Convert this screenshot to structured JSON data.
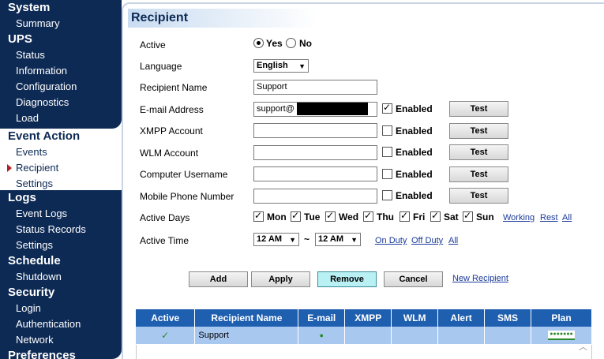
{
  "sidebar": {
    "sections": [
      {
        "title": "System",
        "items": [
          "Summary"
        ]
      },
      {
        "title": "UPS",
        "items": [
          "Status",
          "Information",
          "Configuration",
          "Diagnostics",
          "Load"
        ]
      },
      {
        "title": "Event Action",
        "items": [
          "Events",
          "Recipient",
          "Settings"
        ],
        "selected": "Recipient"
      },
      {
        "title": "Logs",
        "items": [
          "Event Logs",
          "Status Records",
          "Settings"
        ]
      },
      {
        "title": "Schedule",
        "items": [
          "Shutdown"
        ]
      },
      {
        "title": "Security",
        "items": [
          "Login",
          "Authentication",
          "Network"
        ]
      },
      {
        "title": "Preferences",
        "items": []
      }
    ]
  },
  "page": {
    "title": "Recipient"
  },
  "form": {
    "active_label": "Active",
    "active_yes": "Yes",
    "active_no": "No",
    "active_value": "Yes",
    "language_label": "Language",
    "language_value": "English",
    "name_label": "Recipient Name",
    "name_value": "Support",
    "email_label": "E-mail Address",
    "email_value": "support@",
    "email_enabled": true,
    "xmpp_label": "XMPP Account",
    "xmpp_value": "",
    "xmpp_enabled": false,
    "wlm_label": "WLM Account",
    "wlm_value": "",
    "wlm_enabled": false,
    "computer_label": "Computer Username",
    "computer_value": "",
    "computer_enabled": false,
    "mobile_label": "Mobile Phone Number",
    "mobile_value": "",
    "mobile_enabled": false,
    "enabled_label": "Enabled",
    "test_label": "Test",
    "days_label": "Active Days",
    "days": [
      "Mon",
      "Tue",
      "Wed",
      "Thu",
      "Fri",
      "Sat",
      "Sun"
    ],
    "day_links": [
      "Working",
      "Rest",
      "All"
    ],
    "time_label": "Active Time",
    "time_from": "12 AM",
    "time_sep": "~",
    "time_to": "12 AM",
    "time_links": [
      "On Duty",
      "Off Duty",
      "All"
    ]
  },
  "actions": {
    "add": "Add",
    "apply": "Apply",
    "remove": "Remove",
    "cancel": "Cancel",
    "new_recipient": "New Recipient"
  },
  "table": {
    "columns": [
      "Active",
      "Recipient Name",
      "E-mail",
      "XMPP",
      "WLM",
      "Alert",
      "SMS",
      "Plan"
    ],
    "rows": [
      {
        "active": "✓",
        "name": "Support",
        "email": "●",
        "xmpp": "",
        "wlm": "",
        "alert": "",
        "sms": "",
        "plan": "●●●●●●●"
      }
    ]
  },
  "colors": {
    "nav": "#0d2a55",
    "header": "#1f5fb0",
    "row": "#a8c8f0",
    "remove_btn": "#b8f0f4"
  }
}
